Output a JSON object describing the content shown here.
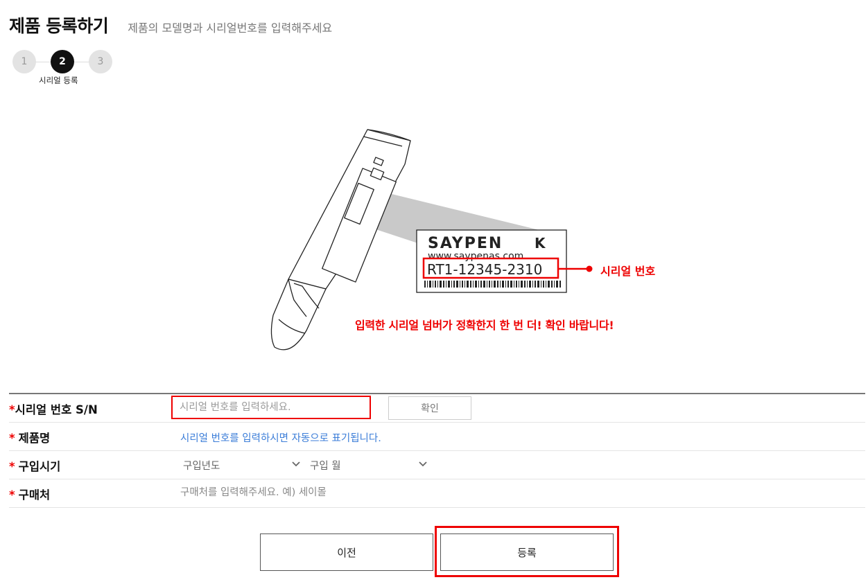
{
  "header": {
    "title": "제품 등록하기",
    "subtitle": "제품의 모델명과 시리얼번호를 입력해주세요"
  },
  "steps": {
    "items": [
      "1",
      "2",
      "3"
    ],
    "current_label": "시리얼 등록"
  },
  "illustration": {
    "label_brand": "SAYPEN",
    "label_url": "www.saypenas.com",
    "label_serial": "RT1-12345-2310",
    "serial_tag": "시리얼 번호",
    "notice": "입력한 시리얼 넘버가 정확한지 한 번 더! 확인 바랍니다!"
  },
  "form": {
    "serial": {
      "required": "*",
      "label": "시리얼 번호 S/N",
      "placeholder": "시리얼 번호를 입력하세요.",
      "confirm_label": "확인"
    },
    "product": {
      "required": "*",
      "label": "제품명",
      "hint": "시리얼 번호를 입력하시면 자동으로 표기됩니다."
    },
    "purchase_date": {
      "required": "*",
      "label": "구입시기",
      "year_value": "구입년도",
      "month_value": "구입 월"
    },
    "store": {
      "required": "*",
      "label": "구매처",
      "placeholder": "구매처를 입력해주세요. 예) 세이몰"
    }
  },
  "buttons": {
    "prev_label": "이전",
    "register_label": "등록"
  },
  "colors": {
    "accent_red": "#e00000",
    "hint_blue": "#3b7dd8",
    "step_active": "#111111"
  }
}
